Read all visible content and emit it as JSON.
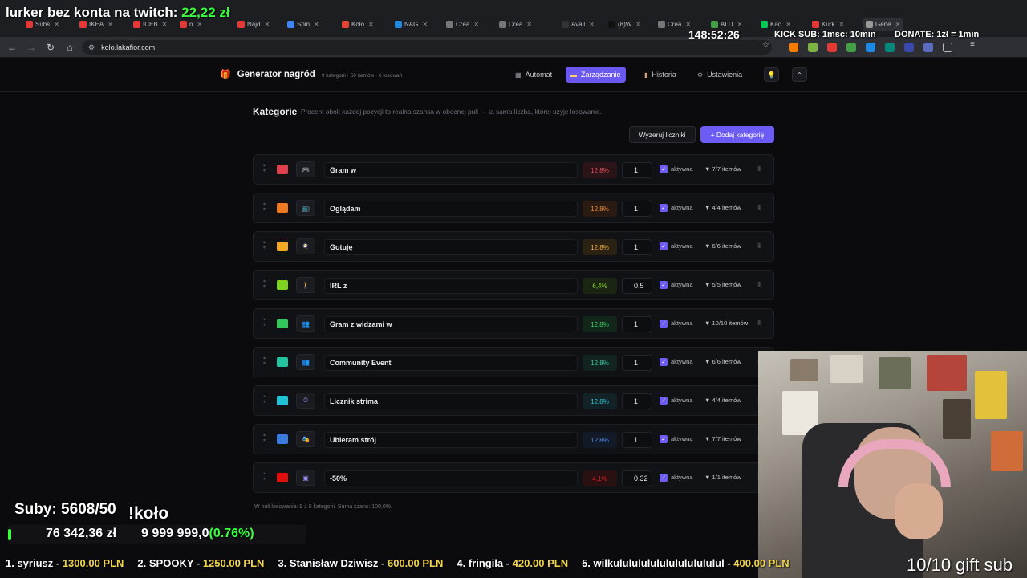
{
  "browser": {
    "tabs": [
      {
        "label": "Subs",
        "color": "#e53935"
      },
      {
        "label": "IKEA",
        "color": "#e53935"
      },
      {
        "label": "ICEB",
        "color": "#e53935"
      },
      {
        "label": "n",
        "color": "#e53935"
      },
      {
        "label": "Najd",
        "color": "#e53935"
      },
      {
        "label": "Spin",
        "color": "#4285f4"
      },
      {
        "label": "Koło",
        "color": "#ea4335"
      },
      {
        "label": "NAG",
        "color": "#1e88e5"
      },
      {
        "label": "Crea",
        "color": "#777"
      },
      {
        "label": "Crea",
        "color": "#777"
      },
      {
        "label": "Avail",
        "color": "#333"
      },
      {
        "label": "(8)W",
        "color": "#111"
      },
      {
        "label": "Crea",
        "color": "#777"
      },
      {
        "label": "AI D",
        "color": "#43a047"
      },
      {
        "label": "Kaq",
        "color": "#00c853"
      },
      {
        "label": "Kurk",
        "color": "#e53935"
      },
      {
        "label": "Gene",
        "color": "#999"
      }
    ],
    "url": "kolo.lakafior.com"
  },
  "stream_overlay": {
    "lurker_text": "lurker bez konta na twitch:",
    "lurker_amount": "22,22 zł",
    "timer": "148:52:26",
    "kick_sub": "KICK SUB: 1msc: 10min",
    "donate": "DONATE: 1zł = 1min",
    "suby": "Suby: 5608/50",
    "kolo_cmd": "!koło",
    "money": "76 342,36 zł",
    "goal": "9 999 999,0",
    "goal_pct": "(0.76%)",
    "goal_progress": 0.0076,
    "gift_sub": "10/10 gift sub",
    "ticker": [
      {
        "name": "1. syriusz - ",
        "amount": "1300.00 PLN"
      },
      {
        "name": "2. SPOOKY - ",
        "amount": "1250.00 PLN"
      },
      {
        "name": "3. Stanisław Dziwisz - ",
        "amount": "600.00 PLN"
      },
      {
        "name": "4. fringila - ",
        "amount": "420.00 PLN"
      },
      {
        "name": "5. wilkulululululululululululul - ",
        "amount": "400.00 PLN"
      }
    ]
  },
  "app": {
    "title": "Generator nagród",
    "meta": "9 kategorii · 50 itemów · 6 losowań",
    "menu": {
      "automat": "Automat",
      "zarzadzanie": "Zarządzanie",
      "historia": "Historia",
      "ustawienia": "Ustawienia"
    }
  },
  "section": {
    "title": "Kategorie",
    "subtitle": "Procent obok każdej pozycji to realna szansa w obecnej puli — ta sama liczba, której użyje losowanie.",
    "reset_label": "Wyzeruj liczniki",
    "add_label": "+ Dodaj kategorię",
    "active_label": "aktywna"
  },
  "categories": [
    {
      "name": "Gram w",
      "color": "#e0404e",
      "icon": "gamepad-icon",
      "glyph": "🎮",
      "pct": "12,8%",
      "pct_color": "#e8505e",
      "pct_bg": "#2a1417",
      "weight": "1",
      "items": "▼ 7/7 itemów"
    },
    {
      "name": "Oglądam",
      "color": "#f07a22",
      "icon": "tv-icon",
      "glyph": "📺",
      "pct": "12,8%",
      "pct_color": "#f28a3a",
      "pct_bg": "#2a1b12",
      "weight": "1",
      "items": "▼ 4/4 itemów"
    },
    {
      "name": "Gotuję",
      "color": "#f0a825",
      "icon": "cooking-icon",
      "glyph": "🍳",
      "pct": "12,8%",
      "pct_color": "#f2b03a",
      "pct_bg": "#2a2212",
      "weight": "1",
      "items": "▼ 6/6 itemów"
    },
    {
      "name": "IRL z",
      "color": "#7ed321",
      "icon": "walking-icon",
      "glyph": "🚶",
      "pct": "6,4%",
      "pct_color": "#8fdc3a",
      "pct_bg": "#1a2612",
      "weight": "0.5",
      "items": "▼ 5/5 itemów"
    },
    {
      "name": "Gram z widzami w",
      "color": "#2ec95a",
      "icon": "people-icon",
      "glyph": "👥",
      "pct": "12,8%",
      "pct_color": "#3fd36a",
      "pct_bg": "#12261a",
      "weight": "1",
      "items": "▼ 10/10 itemów"
    },
    {
      "name": "Community Event",
      "color": "#22c4a0",
      "icon": "community-icon",
      "glyph": "👥",
      "pct": "12,8%",
      "pct_color": "#33ccaa",
      "pct_bg": "#12241f",
      "weight": "1",
      "items": "▼ 6/6 itemów"
    },
    {
      "name": "Licznik strima",
      "color": "#20c2d6",
      "icon": "counter-icon",
      "glyph": "⏱",
      "pct": "12,8%",
      "pct_color": "#33c8db",
      "pct_bg": "#122226",
      "weight": "1",
      "items": "▼ 4/4 itemów"
    },
    {
      "name": "Ubieram strój",
      "color": "#3b7be0",
      "icon": "costume-icon",
      "glyph": "🎭",
      "pct": "12,8%",
      "pct_color": "#4a89ea",
      "pct_bg": "#121a28",
      "weight": "1",
      "items": "▼ 7/7 itemów"
    },
    {
      "name": "-50%",
      "color": "#e01010",
      "icon": "cube-icon",
      "glyph": "▣",
      "pct": "4,1%",
      "pct_color": "#e52020",
      "pct_bg": "#2a1111",
      "weight": "0.32",
      "items": "▼ 1/1 itemów"
    }
  ],
  "footer_note": "W puli losowania: 9 z 9 kategorii. Suma szans: 100,0%."
}
